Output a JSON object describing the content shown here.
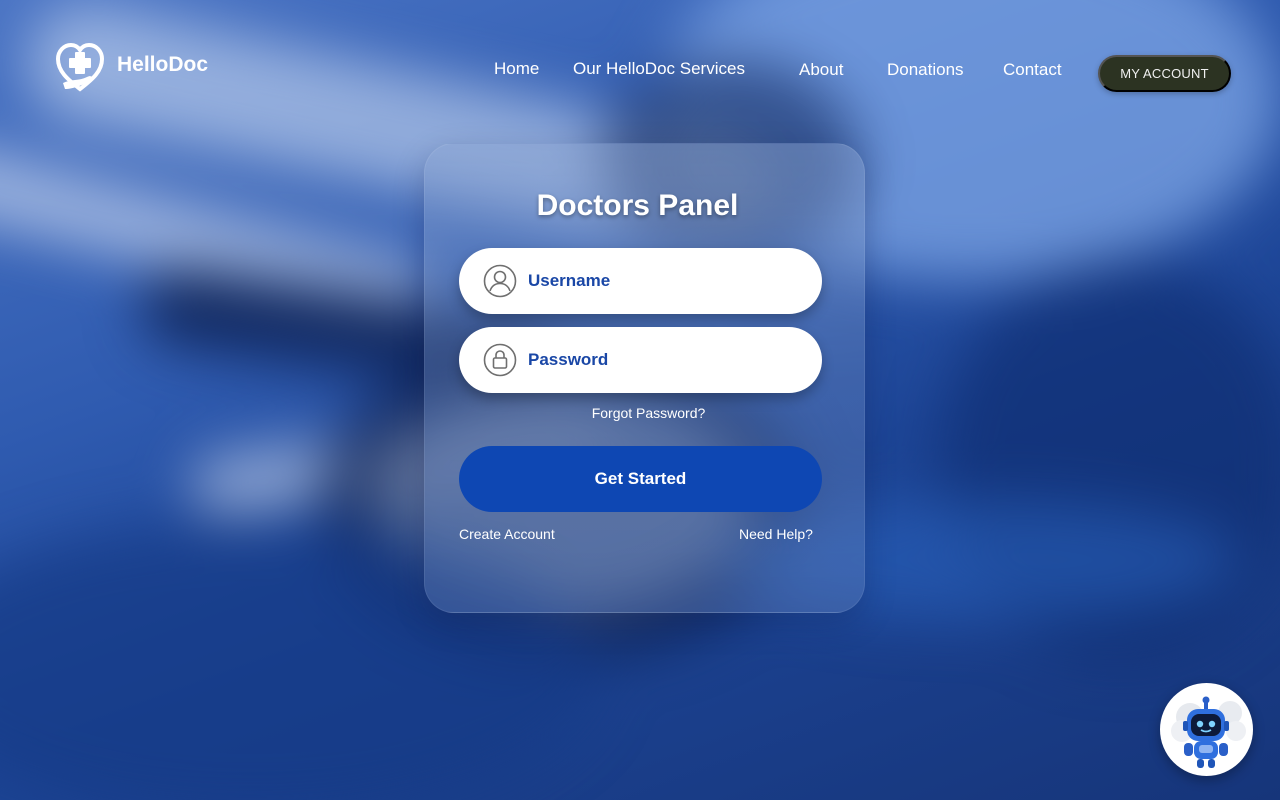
{
  "brand": {
    "name": "HelloDoc",
    "logo_icon": "heart-cross-hand-icon"
  },
  "nav": {
    "items": [
      {
        "label": "Home"
      },
      {
        "label": "Our HelloDoc Services"
      },
      {
        "label": "About"
      },
      {
        "label": "Donations"
      },
      {
        "label": "Contact"
      }
    ],
    "account_label": "MY ACCOUNT"
  },
  "login": {
    "title": "Doctors Panel",
    "username": {
      "placeholder": "Username",
      "value": "",
      "icon": "user-icon"
    },
    "password": {
      "placeholder": "Password",
      "value": "",
      "icon": "lock-icon"
    },
    "forgot_label": "Forgot Password?",
    "submit_label": "Get Started",
    "create_account_label": "Create Account",
    "help_label": "Need Help?"
  },
  "chatbot": {
    "icon": "robot-icon"
  },
  "colors": {
    "accent": "#0e47b3",
    "input_text": "#1a47a6",
    "account_button": "#2c3322"
  }
}
